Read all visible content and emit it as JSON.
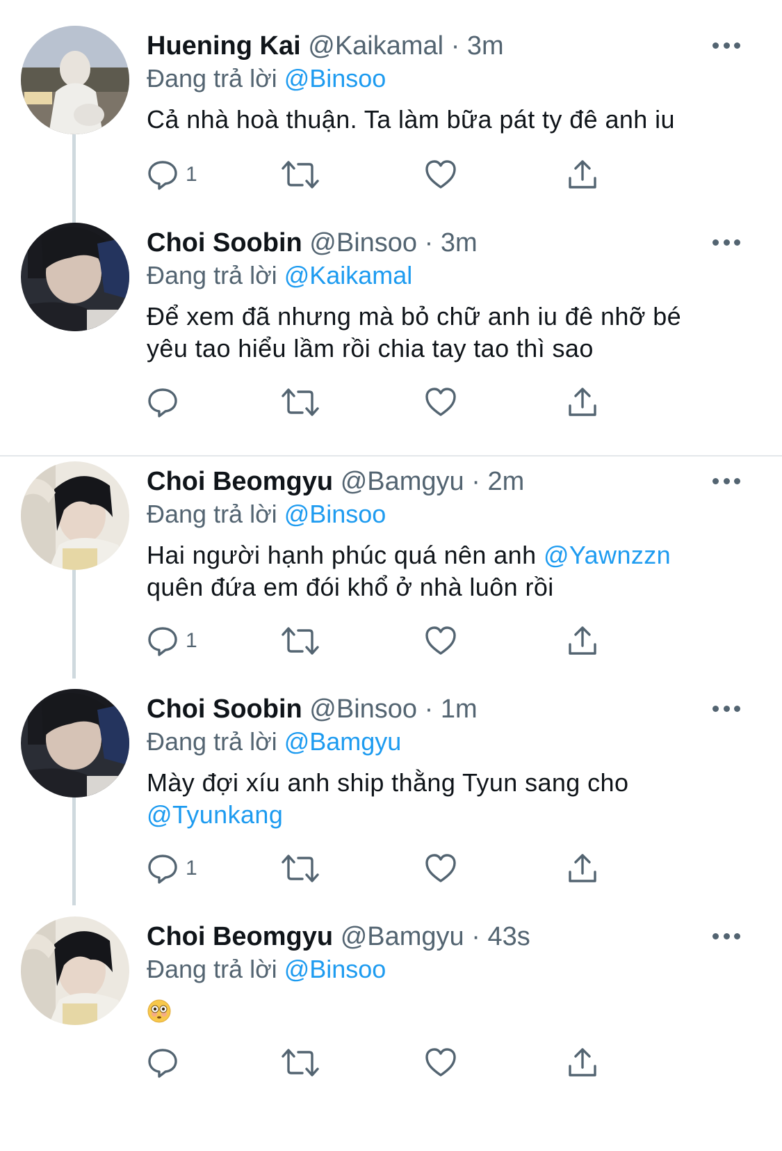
{
  "colors": {
    "accent": "#1d9bf0",
    "text": "#0f1419",
    "muted": "#536471",
    "thread": "#cfd9de"
  },
  "tweets": [
    {
      "name": "Huening Kai",
      "handle": "@Kaikamal",
      "dot": "·",
      "time": "3m",
      "reply_prefix": "Đang trả lời",
      "reply_to": "@Binsoo",
      "body": "Cả nhà hoà thuận. Ta làm bữa pát ty đê anh iu",
      "reply_count": "1"
    },
    {
      "name": "Choi Soobin",
      "handle": "@Binsoo",
      "dot": "·",
      "time": "3m",
      "reply_prefix": "Đang trả lời",
      "reply_to": "@Kaikamal",
      "body_line1": "Để xem đã nhưng mà bỏ chữ anh iu đê nhỡ bé",
      "body_line2": "yêu tao hiểu lầm rồi chia tay tao thì sao",
      "reply_count": ""
    },
    {
      "name": "Choi Beomgyu",
      "handle": "@Bamgyu",
      "dot": "·",
      "time": "2m",
      "reply_prefix": "Đang trả lời",
      "reply_to": "@Binsoo",
      "body_pre": "Hai người hạnh phúc quá nên anh ",
      "body_mention": "@Yawnzzn",
      "body_line2": "quên đứa em đói khổ ở nhà luôn rồi",
      "reply_count": "1"
    },
    {
      "name": "Choi Soobin",
      "handle": "@Binsoo",
      "dot": "·",
      "time": "1m",
      "reply_prefix": "Đang trả lời",
      "reply_to": "@Bamgyu",
      "body_line1": "Mày đợi xíu anh ship thằng Tyun sang cho",
      "body_mention": "@Tyunkang",
      "reply_count": "1"
    },
    {
      "name": "Choi Beomgyu",
      "handle": "@Bamgyu",
      "dot": "·",
      "time": "43s",
      "reply_prefix": "Đang trả lời",
      "reply_to": "@Binsoo",
      "body_emoji": "flushed-face-emoji",
      "reply_count": ""
    }
  ],
  "icons": [
    "reply-icon",
    "retweet-icon",
    "like-icon",
    "share-icon",
    "more-icon"
  ]
}
